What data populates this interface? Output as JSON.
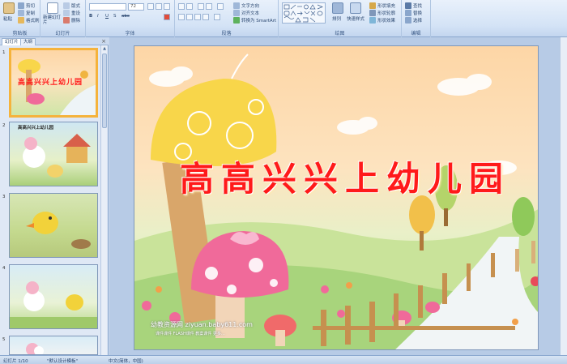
{
  "ribbon": {
    "clipboard": {
      "label": "剪贴板",
      "paste": "粘贴",
      "cut": "剪切",
      "copy": "复制",
      "format_painter": "格式刷"
    },
    "slides": {
      "label": "幻灯片",
      "new_slide": "新建幻灯片",
      "layout": "版式",
      "reset": "重设",
      "delete": "删除"
    },
    "font": {
      "label": "字体",
      "font_size": "72",
      "bold": "B",
      "italic": "I",
      "underline": "U",
      "strike": "abc",
      "shadow": "S"
    },
    "paragraph": {
      "label": "段落",
      "text_direction": "文字方向",
      "align_text": "对齐文本",
      "smartart": "转换为 SmartArt"
    },
    "drawing": {
      "label": "绘图",
      "arrange": "排列",
      "quick_styles": "快速样式",
      "shape_fill": "形状填充",
      "shape_outline": "形状轮廓",
      "shape_effects": "形状效果"
    },
    "editing": {
      "label": "编辑",
      "find": "查找",
      "replace": "替换",
      "select": "选择"
    }
  },
  "pane": {
    "tab_slides": "幻灯片",
    "tab_outline": "大纲",
    "close": "×",
    "slide_numbers": [
      "1",
      "2",
      "3",
      "4",
      "5"
    ],
    "thumb_titles": [
      "高高兴兴上幼儿园",
      "高高兴兴上幼儿园"
    ]
  },
  "slide": {
    "title": "高高兴兴上幼儿园",
    "watermark": "幼教资源网 ziyuan.baby611.com",
    "watermark_sub": "课件课件 FLASH课件 教案课件 更多…"
  },
  "status": {
    "slide_pos": "幻灯片 1/10",
    "theme": "\"默认设计模板\"",
    "language": "中文(简体，中国)"
  },
  "colors": {
    "title_red": "#ff1a1a",
    "selection": "#f5b33c",
    "ribbon": "#d4e3f6"
  }
}
